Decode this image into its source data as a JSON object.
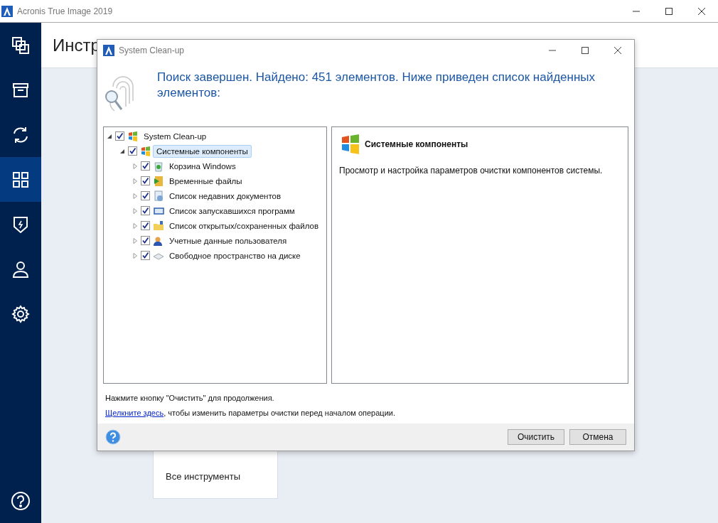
{
  "app_window": {
    "title": "Acronis True Image 2019"
  },
  "sidebar": {
    "items": [
      {
        "selected": false
      },
      {
        "selected": false
      },
      {
        "selected": false
      },
      {
        "selected": true
      },
      {
        "selected": false
      },
      {
        "selected": false
      },
      {
        "selected": false
      }
    ]
  },
  "main": {
    "title": "Инстр",
    "card_label": "Все инструменты"
  },
  "dialog": {
    "title": "System Clean-up",
    "heading": "Поиск завершен. Найдено: 451 элементов. Ниже приведен список найденных элементов:",
    "tree": [
      {
        "label": "System Clean-up",
        "checked": true,
        "expanded": true,
        "selected": false,
        "children": [
          {
            "label": "Системные компоненты",
            "checked": true,
            "expanded": true,
            "selected": true,
            "children": [
              {
                "label": "Корзина Windows",
                "checked": true,
                "expanded": false,
                "selected": false
              },
              {
                "label": "Временные файлы",
                "checked": true,
                "expanded": false,
                "selected": false
              },
              {
                "label": "Список недавних документов",
                "checked": true,
                "expanded": false,
                "selected": false
              },
              {
                "label": "Список запускавшихся программ",
                "checked": true,
                "expanded": false,
                "selected": false
              },
              {
                "label": "Список открытых/сохраненных файлов",
                "checked": true,
                "expanded": false,
                "selected": false
              },
              {
                "label": "Учетные данные пользователя",
                "checked": true,
                "expanded": false,
                "selected": false
              },
              {
                "label": "Свободное пространство на диске",
                "checked": true,
                "expanded": false,
                "selected": false
              }
            ]
          }
        ]
      }
    ],
    "details": {
      "title": "Системные компоненты",
      "description": "Просмотр и настройка параметров очистки компонентов системы."
    },
    "hint": "Нажмите кнопку \"Очистить\" для продолжения.",
    "link": "Щелкните здесь",
    "link_rest": ", чтобы изменить параметры очистки перед началом операции.",
    "buttons": [
      "Очистить",
      "Отмена"
    ]
  }
}
